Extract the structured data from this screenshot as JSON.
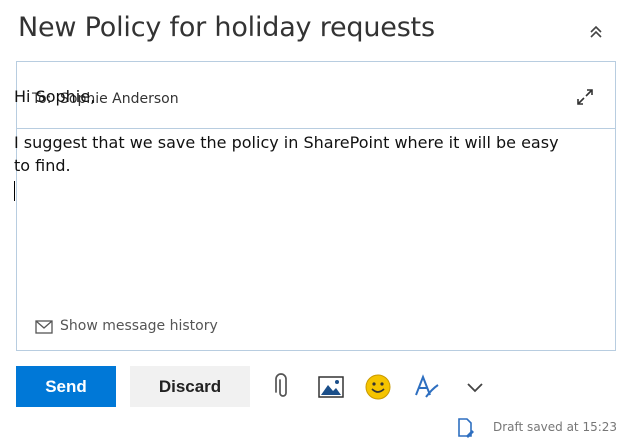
{
  "subject": "New Policy for holiday requests",
  "recipients": {
    "label": "To:",
    "value": "Sophie Anderson"
  },
  "body": {
    "greeting": "Hi Sophie,",
    "paragraph": "I suggest that we save the policy in SharePoint where it will be easy to find."
  },
  "history_link": "Show message history",
  "actions": {
    "send_label": "Send",
    "discard_label": "Discard"
  },
  "toolbar_icons": [
    "paperclip-icon",
    "image-icon",
    "emoji-icon",
    "format-text-icon",
    "chevron-down-icon"
  ],
  "status": {
    "draft_saved": "Draft saved at 15:23"
  },
  "colors": {
    "accent": "#0078d7",
    "border": "#b8cde0",
    "emoji": "#f5c400"
  }
}
